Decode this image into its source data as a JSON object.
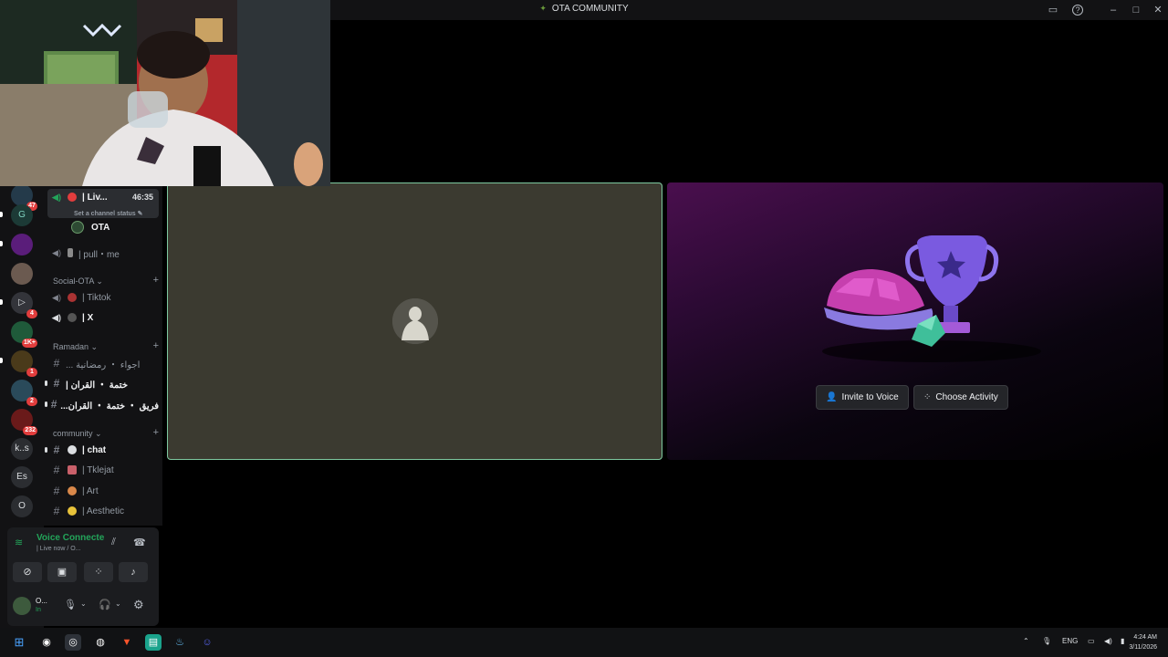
{
  "window": {
    "title": "OTA COMMUNITY",
    "logo_icon": "ota-logo-icon",
    "controls": {
      "inbox": "▭",
      "help": "?",
      "minimize": "–",
      "maximize": "□",
      "close": "✕"
    }
  },
  "servers": [
    {
      "label": "",
      "badge": "47"
    },
    {
      "label": "G",
      "badge": ""
    },
    {
      "label": "",
      "badge": ""
    },
    {
      "label": "",
      "badge": ""
    },
    {
      "label": "▷",
      "badge": "4"
    },
    {
      "label": "",
      "badge": "1K+"
    },
    {
      "label": "",
      "badge": "1"
    },
    {
      "label": "",
      "badge": "2"
    },
    {
      "label": "",
      "badge": "232"
    },
    {
      "label": "k..s",
      "badge": ""
    },
    {
      "label": "Es",
      "badge": ""
    },
    {
      "label": "O",
      "badge": ""
    }
  ],
  "channels": {
    "live": {
      "name": "| Liv...",
      "timer": "46:35",
      "status_placeholder": "Set a channel status ✎"
    },
    "member": "OTA",
    "voice1": "| pull・me",
    "cat_social": "Social-OTA ⌄",
    "tiktok": "| Tiktok",
    "x": "| X",
    "cat_ramadan": "Ramadan ⌄",
    "ramadan1": "... اجواء ・ رمضانية",
    "ramadan2": "| ختمة ・ القران",
    "ramadan3": "...فريق ・ ختمة ・ القران",
    "cat_community": "community ⌄",
    "chat": "| chat",
    "tklejat": "| Tklejat",
    "art": "| Art",
    "aesthetic": "| Aesthetic",
    "plus": "+"
  },
  "voice_panel": {
    "title": "Voice Connecte",
    "subtitle": "| Live now / O...",
    "user_name": "O...",
    "user_status": "In"
  },
  "stage": {
    "invite_label": "Invite to Voice",
    "activity_label": "Choose Activity"
  },
  "taskbar": {
    "lang": "ENG",
    "time": "4:24 AM",
    "date": "3/11/2026"
  },
  "colors": {
    "accent_green": "#23a55a",
    "speaking_border": "#7ec9a0",
    "danger": "#e23d3d"
  }
}
